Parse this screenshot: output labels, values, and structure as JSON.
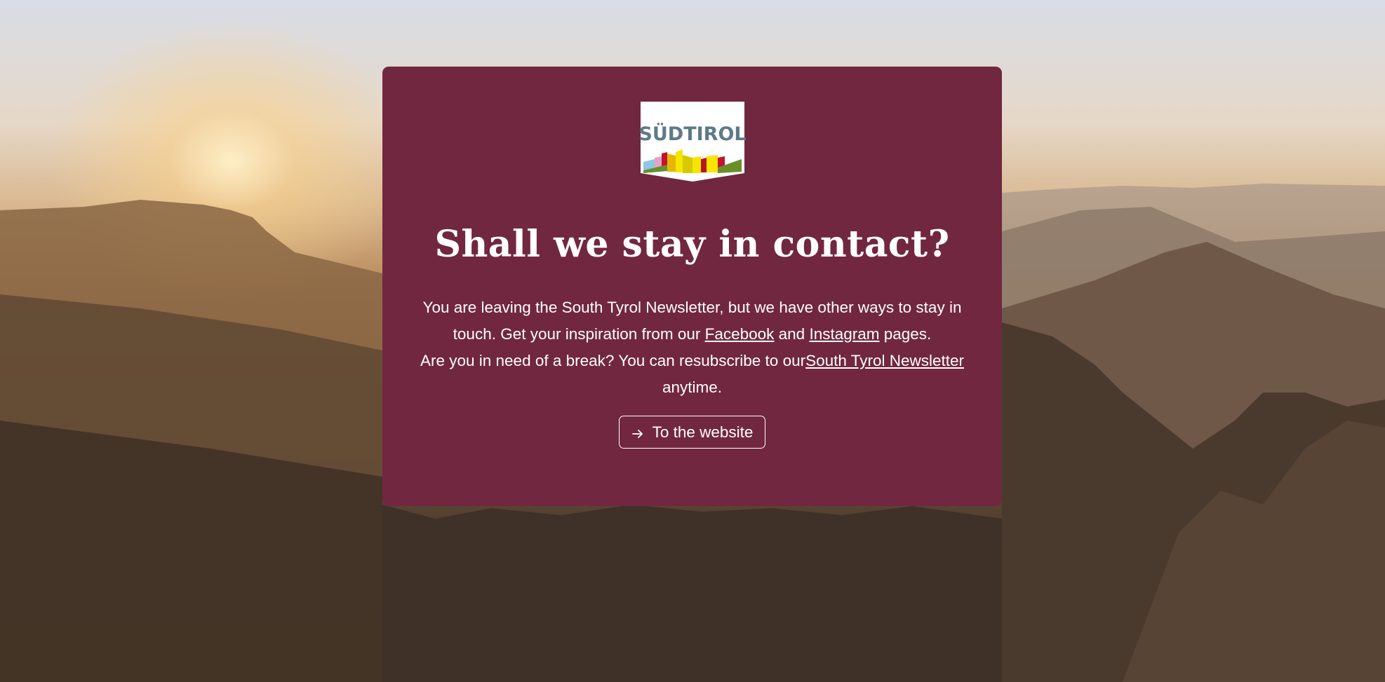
{
  "brand": {
    "logo_text": "SÜDTIROL"
  },
  "dialog": {
    "heading": "Shall we stay in contact?",
    "line1_pre": "You are leaving the South Tyrol Newsletter, but we have other ways to stay in touch. Get your inspiration from our ",
    "facebook_link": "Facebook",
    "line1_mid": " and ",
    "instagram_link": "Instagram",
    "line1_post": " pages.",
    "line2_pre": "Are you in need of a break? You can resubscribe to our",
    "newsletter_link": "South Tyrol Newsletter",
    "line2_post": " anytime.",
    "button_label": "To the website",
    "button_icon": "arrow-right-icon"
  },
  "colors": {
    "card_background": "#712740",
    "text": "#ffffff",
    "logo_text": "#5f7a86"
  }
}
